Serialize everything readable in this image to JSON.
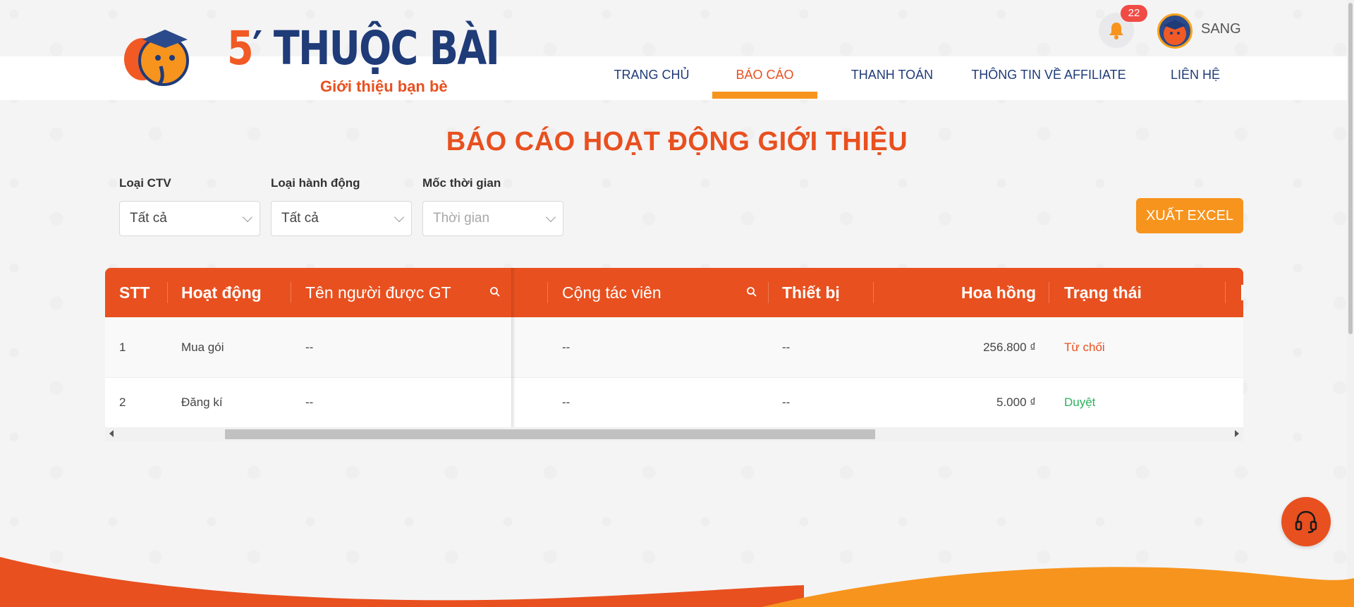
{
  "brand": {
    "five": "5",
    "name": "THUỘC BÀI",
    "tagline": "Giới thiệu bạn bè"
  },
  "nav": {
    "items": [
      {
        "label": "TRANG CHỦ"
      },
      {
        "label": "BÁO CÁO"
      },
      {
        "label": "THANH TOÁN"
      },
      {
        "label": "THÔNG TIN VỀ AFFILIATE"
      },
      {
        "label": "LIÊN HỆ"
      }
    ],
    "active": "BÁO CÁO"
  },
  "user": {
    "notification_count": "22",
    "name": "SANG"
  },
  "page": {
    "title": "BÁO CÁO HOẠT ĐỘNG GIỚI THIỆU"
  },
  "filters": [
    {
      "label": "Loại CTV",
      "value": "Tất cả"
    },
    {
      "label": "Loại hành động",
      "value": "Tất cả"
    },
    {
      "label": "Mốc thời gian",
      "placeholder": "Thời gian"
    }
  ],
  "export_label": "XUẤT EXCEL",
  "table": {
    "columns": [
      "STT",
      "Hoạt động",
      "Tên người được GT",
      "Cộng tác viên",
      "Thiết bị",
      "Hoa hồng",
      "Trạng thái"
    ],
    "rows": [
      {
        "stt": "1",
        "activity": "Mua gói",
        "referee": "--",
        "ctv": "--",
        "device": "--",
        "commission": "256.800 ₫",
        "status": "Từ chối"
      },
      {
        "stt": "2",
        "activity": "Đăng kí",
        "referee": "--",
        "ctv": "--",
        "device": "--",
        "commission": "5.000 ₫",
        "status": "Duyệt"
      }
    ]
  },
  "colors": {
    "primary": "#e8501f",
    "accent": "#f7941d",
    "navy": "#1f3b78",
    "success": "#2bb35e"
  },
  "icons": [
    "bell-icon",
    "search-icon",
    "headset-icon",
    "chevron-down-icon"
  ]
}
